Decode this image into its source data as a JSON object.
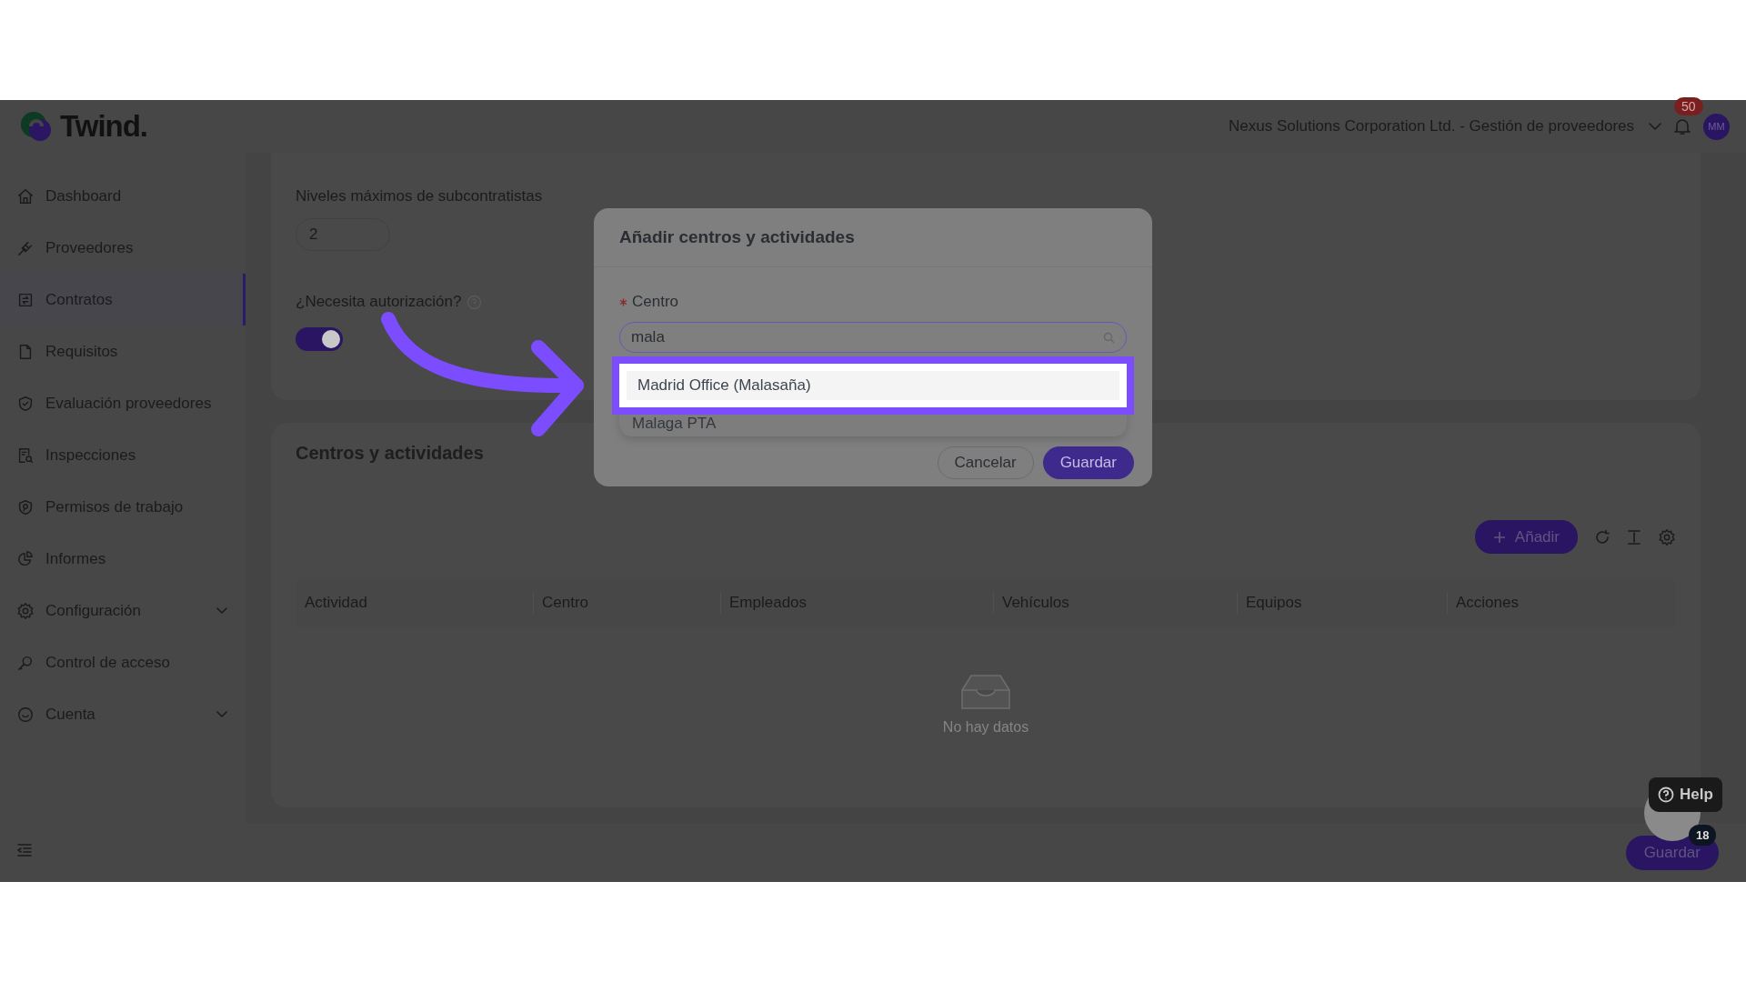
{
  "logo": {
    "text": "Twind."
  },
  "sidebar": {
    "items": [
      {
        "label": "Dashboard",
        "selected": false,
        "has_submenu": false
      },
      {
        "label": "Proveedores",
        "selected": false,
        "has_submenu": false
      },
      {
        "label": "Contratos",
        "selected": true,
        "has_submenu": false
      },
      {
        "label": "Requisitos",
        "selected": false,
        "has_submenu": false
      },
      {
        "label": "Evaluación proveedores",
        "selected": false,
        "has_submenu": false
      },
      {
        "label": "Inspecciones",
        "selected": false,
        "has_submenu": false
      },
      {
        "label": "Permisos de trabajo",
        "selected": false,
        "has_submenu": false
      },
      {
        "label": "Informes",
        "selected": false,
        "has_submenu": false
      },
      {
        "label": "Configuración",
        "selected": false,
        "has_submenu": true
      },
      {
        "label": "Control de acceso",
        "selected": false,
        "has_submenu": false
      },
      {
        "label": "Cuenta",
        "selected": false,
        "has_submenu": true
      }
    ]
  },
  "header": {
    "org_selector": "Nexus Solutions Corporation Ltd. - Gestión de proveedores",
    "notifications_badge": "50",
    "avatar": "MM"
  },
  "settings_card": {
    "subcontractor_levels": {
      "label": "Niveles máximos de subcontratistas",
      "value": "2"
    },
    "authorization": {
      "label": "¿Necesita autorización?",
      "on": true
    }
  },
  "centers_card": {
    "title": "Centros y actividades",
    "add_button": "Añadir",
    "table": {
      "columns": [
        "Actividad",
        "Centro",
        "Empleados",
        "Vehículos",
        "Equipos",
        "Acciones"
      ],
      "empty_text": "No hay datos"
    }
  },
  "footer": {
    "save_button": "Guardar"
  },
  "help_widget": {
    "label": "Help",
    "badge": "18"
  },
  "modal": {
    "title": "Añadir centros y actividades",
    "field": {
      "label": "Centro",
      "required": true,
      "value": "mala"
    },
    "options": [
      {
        "label": "Madrid Office (Malasaña)",
        "selected": true
      },
      {
        "label": "Malaga PTA",
        "selected": false
      }
    ],
    "buttons": [
      {
        "label": "Cancelar",
        "kind": "default"
      },
      {
        "label": "Guardar",
        "kind": "primary"
      }
    ]
  }
}
